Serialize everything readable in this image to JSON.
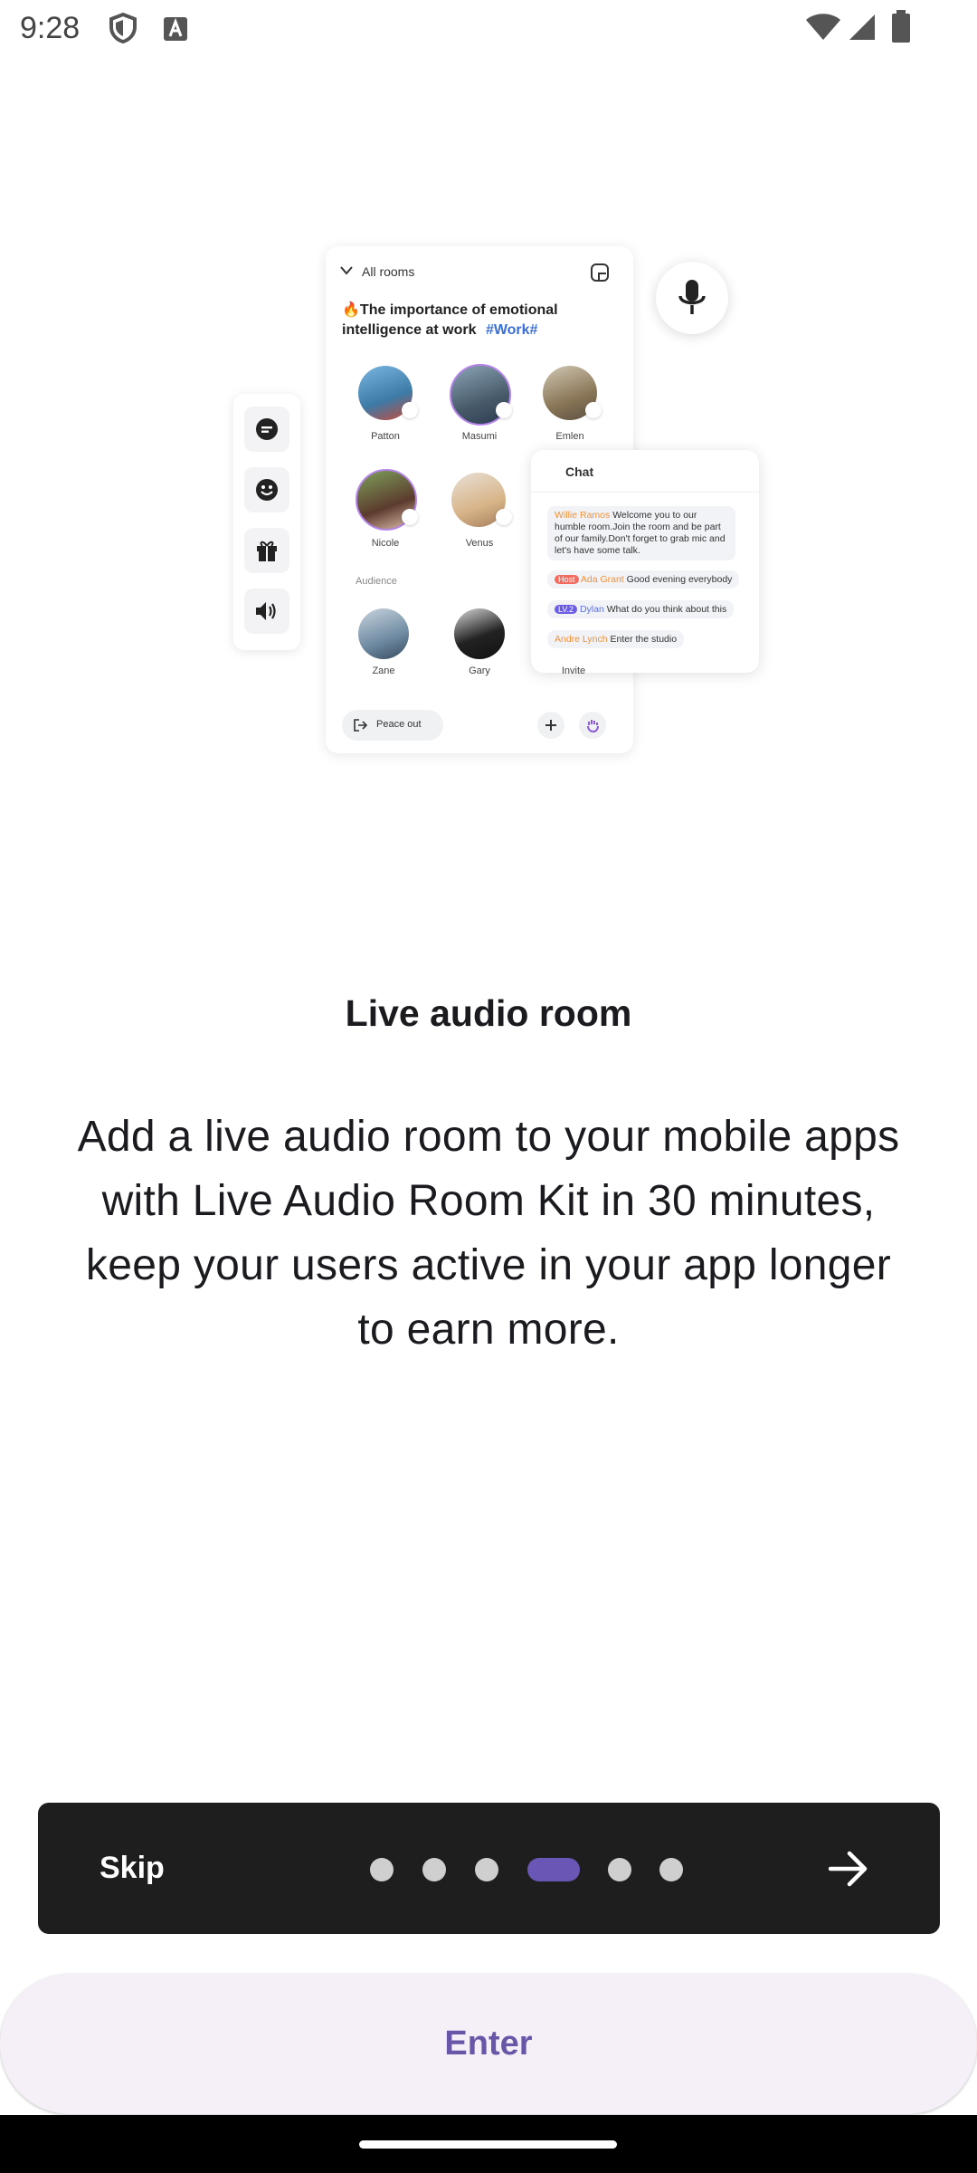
{
  "status_bar": {
    "time": "9:28",
    "icons": [
      "shield-icon",
      "a-badge-icon",
      "wifi-icon",
      "cell-signal-icon",
      "battery-icon"
    ]
  },
  "illustration": {
    "header": "All rooms",
    "room_title": "🔥The importance of emotional intelligence at work",
    "room_tag": "#Work#",
    "speakers": [
      "Patton",
      "Masumi",
      "Emlen",
      "Nicole",
      "Venus"
    ],
    "audience_label": "Audience",
    "audience": [
      "Zane",
      "Gary",
      "Invite"
    ],
    "leave_label": "Peace out",
    "chat": {
      "title": "Chat",
      "messages": [
        {
          "user": "Willie Ramos",
          "text": "Welcome you to our humble room.Join the room and be part of our family.Don't forget to grab mic and let's have some talk."
        },
        {
          "badge": "Host",
          "user": "Ada Grant",
          "text": "Good evening everybody"
        },
        {
          "badge": "LV.2",
          "user": "Dylan",
          "text": "What do you think about this"
        },
        {
          "user": "Andre Lynch",
          "text": "Enter the studio"
        }
      ]
    }
  },
  "content": {
    "title": "Live audio room",
    "description": "Add a live audio room to your mobile apps with Live Audio Room Kit in 30 minutes, keep your users active in your app longer to earn more."
  },
  "pager": {
    "skip_label": "Skip",
    "total_pages": 6,
    "current_page": 4,
    "next_icon": "arrow-right-icon"
  },
  "enter_button": {
    "label": "Enter"
  },
  "colors": {
    "accent": "#6a56b5",
    "nav_bg": "#1e1e1e",
    "enter_bg": "#f5f0f7",
    "enter_text": "#6a56a8"
  }
}
